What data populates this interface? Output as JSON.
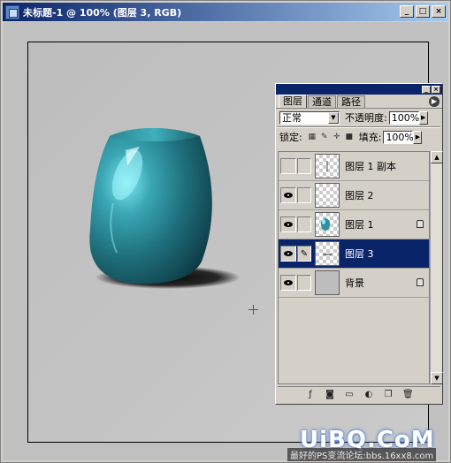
{
  "window": {
    "title": "未标题-1 @ 100% (图层 3, RGB)",
    "buttons": {
      "minimize": "_",
      "maximize": "□",
      "close": "×"
    }
  },
  "palette": {
    "tabs": [
      {
        "label": "图层"
      },
      {
        "label": "通道"
      },
      {
        "label": "路径"
      }
    ],
    "blend_mode": "正常",
    "opacity_label": "不透明度:",
    "opacity_value": "100%",
    "lock_label": "锁定:",
    "fill_label": "填充:",
    "fill_value": "100%",
    "layers": [
      {
        "name": "图层 1 副本",
        "visible": false,
        "selected": false,
        "locked": false
      },
      {
        "name": "图层 2",
        "visible": true,
        "selected": false,
        "locked": false
      },
      {
        "name": "图层 1",
        "visible": true,
        "selected": false,
        "locked": true
      },
      {
        "name": "图层 3",
        "visible": true,
        "selected": true,
        "locked": false
      },
      {
        "name": "背景",
        "visible": true,
        "selected": false,
        "locked": true
      }
    ]
  },
  "watermark": {
    "logo": "UiBQ.CoM",
    "url": "最好的PS变流论坛:bbs.16xx8.com"
  },
  "colors": {
    "titlebar": "#0a246a",
    "selection": "#0a246a",
    "vase": "#2f8f9a"
  }
}
